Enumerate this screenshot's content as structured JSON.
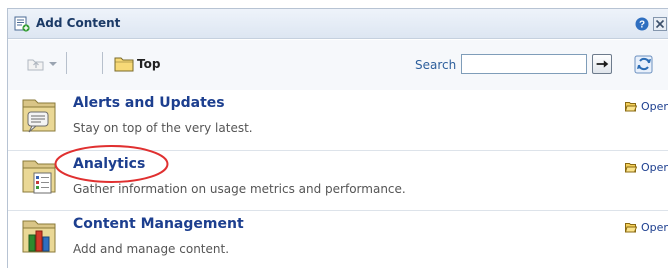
{
  "header": {
    "title": "Add Content",
    "icons": [
      "add-content-icon",
      "help-icon",
      "close-icon"
    ]
  },
  "toolbar": {
    "breadcrumb_label": "Top",
    "search_label": "Search",
    "search_value": "",
    "icons": [
      "folder-up-icon",
      "dropdown-arrow-icon",
      "folder-icon",
      "go-arrow-icon",
      "refresh-icon"
    ]
  },
  "items": [
    {
      "title": "Alerts and Updates",
      "description": "Stay on top of the very latest.",
      "open_label": "Open",
      "icon": "alerts-folder-icon"
    },
    {
      "title": "Analytics",
      "description": "Gather information on usage metrics and performance.",
      "open_label": "Open",
      "icon": "analytics-folder-icon"
    },
    {
      "title": "Content Management",
      "description": "Add and manage content.",
      "open_label": "Open",
      "icon": "content-management-folder-icon"
    }
  ],
  "colors": {
    "title_blue": "#1d3f8f",
    "highlight_red": "#e03030",
    "header_bg": "#dde6f2"
  }
}
